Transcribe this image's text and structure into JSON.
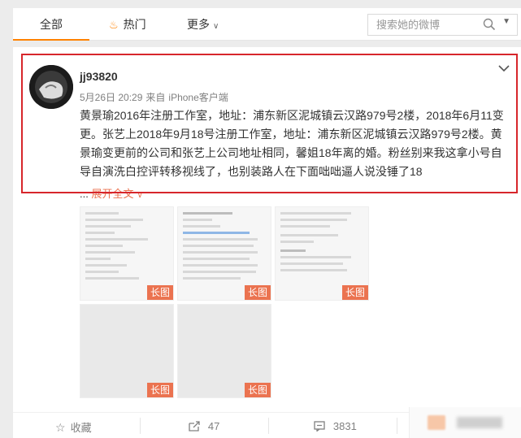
{
  "tabs": {
    "all": "全部",
    "hot": "热门",
    "more": "更多"
  },
  "search": {
    "placeholder": "搜索她的微博"
  },
  "post": {
    "username": "jj93820",
    "date": "5月26日 20:29",
    "source_prefix": "来自",
    "source": "iPhone客户端",
    "text": "黄景瑜2016年注册工作室，地址：浦东新区泥城镇云汉路979号2楼，2018年6月11变更。张艺上2018年9月18号注册工作室，地址：浦东新区泥城镇云汉路979号2楼。黄景瑜变更前的公司和张艺上公司地址相同，馨姐18年离的婚。粉丝别来我这拿小号自导自演洗白控评转移视线了，也别装路人在下面咄咄逼人说没锤了18",
    "expand_prefix": "...",
    "expand_label": "展开全文",
    "long_image_label": "长图"
  },
  "actions": {
    "favorite": "收藏",
    "repost_count": "47",
    "comment_count": "3831"
  },
  "colors": {
    "accent": "#ff8200",
    "link": "#eb7350",
    "highlight": "#d7262b"
  },
  "icons": {
    "hot": "flame-icon",
    "search": "search-icon",
    "favorite": "star-icon",
    "repost": "repost-icon",
    "comment": "comment-icon",
    "menu": "chevron-down-icon"
  }
}
